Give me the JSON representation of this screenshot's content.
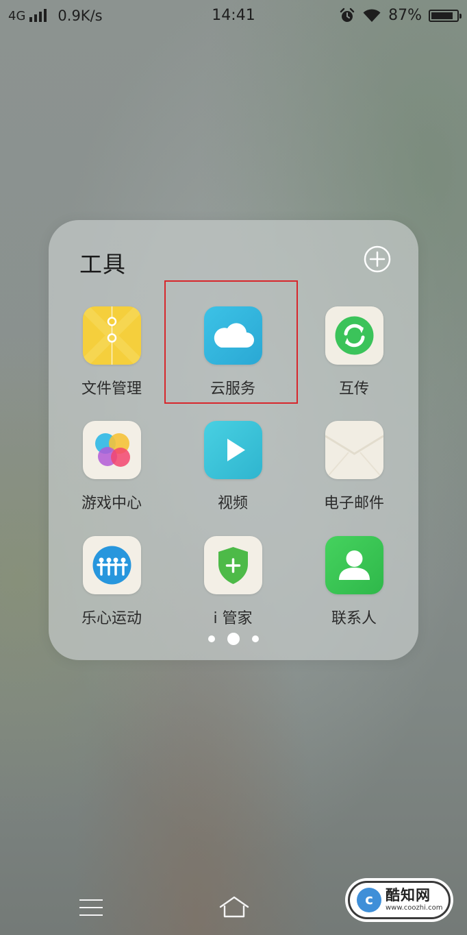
{
  "status_bar": {
    "network_type": "4G",
    "speed": "0.9K/s",
    "time": "14:41",
    "battery": "87%",
    "battery_level": 0.87,
    "icons": [
      "signal-icon",
      "alarm-icon",
      "wifi-icon",
      "battery-icon"
    ]
  },
  "folder": {
    "title": "工具",
    "add_icon": "plus-circle-icon",
    "apps": [
      {
        "label": "文件管理",
        "icon": "file-manager-icon",
        "color": "#f5cf3c"
      },
      {
        "label": "云服务",
        "icon": "cloud-icon",
        "color": "#30b7dd",
        "highlighted": true
      },
      {
        "label": "互传",
        "icon": "transfer-icon",
        "color": "#3bc35a"
      },
      {
        "label": "游戏中心",
        "icon": "game-center-icon",
        "color": "#f3efe6"
      },
      {
        "label": "视频",
        "icon": "video-play-icon",
        "color": "#3cc6da"
      },
      {
        "label": "电子邮件",
        "icon": "email-icon",
        "color": "#f1ede3"
      },
      {
        "label": "乐心运动",
        "icon": "sports-icon",
        "color": "#2796dd"
      },
      {
        "label": "i 管家",
        "icon": "shield-icon",
        "color": "#4dba48"
      },
      {
        "label": "联系人",
        "icon": "contacts-icon",
        "color": "#38c752"
      }
    ],
    "pages": 3,
    "current_page": 2,
    "highlight_color": "#d7262b"
  },
  "nav": {
    "menu_icon": "menu-icon",
    "home_icon": "home-icon"
  },
  "watermark": {
    "logo_letter": "c",
    "name": "酷知网",
    "url": "www.coozhi.com"
  }
}
